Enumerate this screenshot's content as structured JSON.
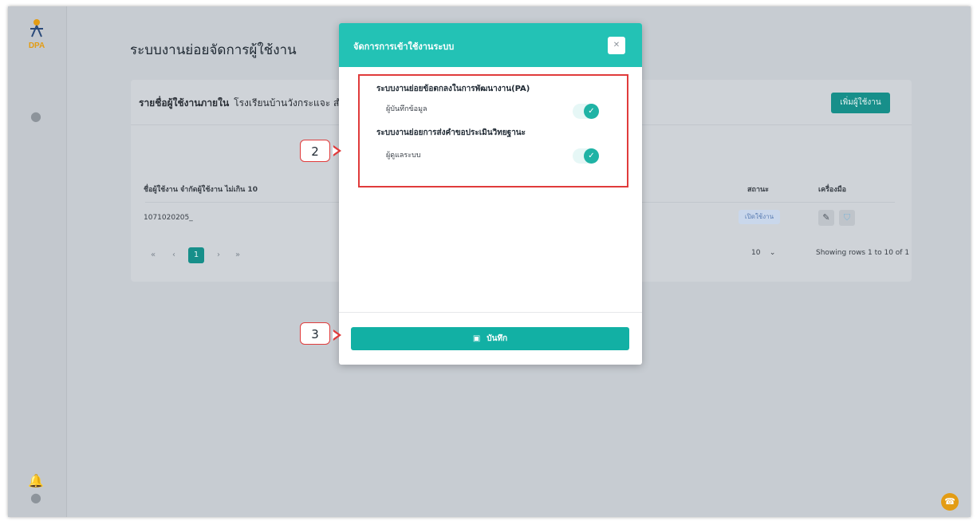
{
  "page": {
    "title": "ระบบงานย่อยจัดการผู้ใช้งาน"
  },
  "card": {
    "title_bold": "รายชื่อผู้ใช้งานภายใน",
    "title_rest": "โรงเรียนบ้านวังกระแจะ สำ",
    "add_button": "เพิ่มผู้ใช้งาน",
    "columns": {
      "user": "ชื่อผู้ใช้งาน จำกัดผู้ใช้งาน ไม่เกิน 10",
      "status": "สถานะ",
      "tools": "เครื่องมือ"
    },
    "rows": [
      {
        "user": "1071020205_",
        "status": "เปิดใช้งาน"
      }
    ],
    "pager": {
      "first": "«",
      "prev": "‹",
      "current": "1",
      "next": "›",
      "last": "»"
    },
    "rows_per_page": "10",
    "rows_info": "Showing rows 1 to 10 of 1"
  },
  "modal": {
    "title": "จัดการการเข้าใช้งานระบบ",
    "groups": [
      {
        "name": "ระบบงานย่อยข้อตกลงในการพัฒนางาน(PA)",
        "role": "ผู้บันทึกข้อมูล",
        "enabled": true
      },
      {
        "name": "ระบบงานย่อยการส่งคำขอประเมินวิทยฐานะ",
        "role": "ผู้ดูแลระบบ",
        "enabled": true
      }
    ],
    "save_label": "บันทึก"
  },
  "annotations": {
    "callout_2": "2",
    "callout_3": "3"
  },
  "colors": {
    "accent": "#23c2b5",
    "accent_dark": "#178f8a",
    "annotation_red": "#e03b3b",
    "chat": "#e39c14"
  },
  "icons": {
    "logo": "dpa-logo",
    "user": "user-icon",
    "bell": "bell-icon",
    "close": "close-icon",
    "save": "save-icon",
    "edit": "edit-icon",
    "shield": "shield-icon",
    "chat": "headset-icon"
  }
}
